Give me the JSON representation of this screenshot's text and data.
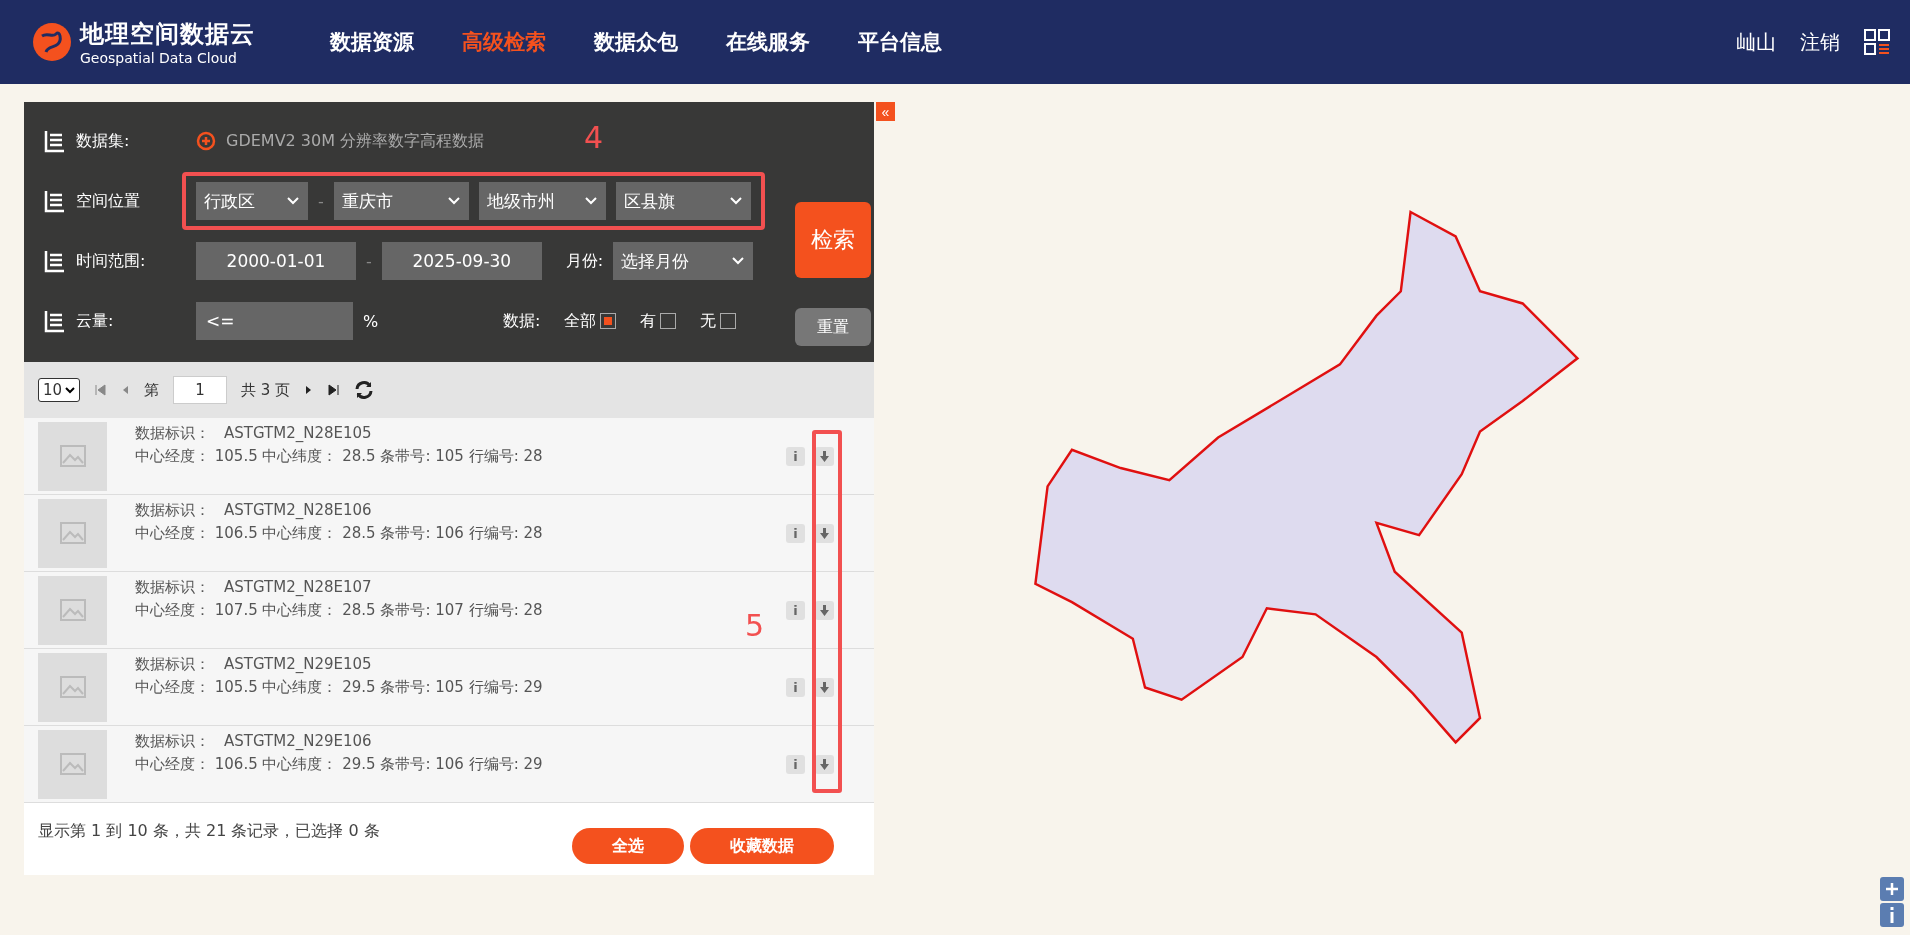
{
  "header": {
    "logo": {
      "title": "地理空间数据云",
      "subtitle": "Geospatial Data Cloud"
    },
    "nav": [
      {
        "label": "数据资源",
        "selected": false
      },
      {
        "label": "高级检索",
        "selected": true
      },
      {
        "label": "数据众包",
        "selected": false
      },
      {
        "label": "在线服务",
        "selected": false
      },
      {
        "label": "平台信息",
        "selected": false
      }
    ],
    "user": "屾山",
    "logout": "注销"
  },
  "panel": {
    "collapse": "«",
    "dataset": {
      "label": "数据集:",
      "value": "GDEMV2 30M 分辨率数字高程数据"
    },
    "location": {
      "label": "空间位置",
      "separator": "-",
      "selects": [
        "行政区",
        "重庆市",
        "地级市州",
        "区县旗"
      ]
    },
    "time": {
      "label": "时间范围:",
      "separator": "-",
      "start": "2000-01-01",
      "end": "2025-09-30",
      "month_label": "月份:",
      "month_value": "选择月份"
    },
    "cloud": {
      "label": "云量:",
      "value": "<=",
      "unit": "%",
      "data_label": "数据:",
      "options": [
        {
          "label": "全部",
          "checked": true
        },
        {
          "label": "有",
          "checked": false
        },
        {
          "label": "无",
          "checked": false
        }
      ]
    },
    "search_button": "检索",
    "reset_button": "重置"
  },
  "pager": {
    "page_size": "10",
    "page_prefix": "第",
    "page": "1",
    "page_total": "共 3 页"
  },
  "records": [
    {
      "id_label": "数据标识：",
      "id": "ASTGTM2_N28E105",
      "info": "i",
      "detail": "中心经度： 105.5 中心纬度： 28.5 条带号: 105 行编号: 28"
    },
    {
      "id_label": "数据标识：",
      "id": "ASTGTM2_N28E106",
      "info": "i",
      "detail": "中心经度： 106.5 中心纬度： 28.5 条带号: 106 行编号: 28"
    },
    {
      "id_label": "数据标识：",
      "id": "ASTGTM2_N28E107",
      "info": "i",
      "detail": "中心经度： 107.5 中心纬度： 28.5 条带号: 107 行编号: 28"
    },
    {
      "id_label": "数据标识：",
      "id": "ASTGTM2_N29E105",
      "info": "i",
      "detail": "中心经度： 105.5 中心纬度： 29.5 条带号: 105 行编号: 29"
    },
    {
      "id_label": "数据标识：",
      "id": "ASTGTM2_N29E106",
      "info": "i",
      "detail": "中心经度： 106.5 中心纬度： 29.5 条带号: 106 行编号: 29"
    }
  ],
  "footer": {
    "summary": "显示第 1 到 10 条，共 21 条记录，已选择 0 条",
    "buttons": [
      "全选",
      "收藏数据"
    ]
  },
  "annotations": [
    {
      "label": "4"
    },
    {
      "label": "5"
    }
  ]
}
